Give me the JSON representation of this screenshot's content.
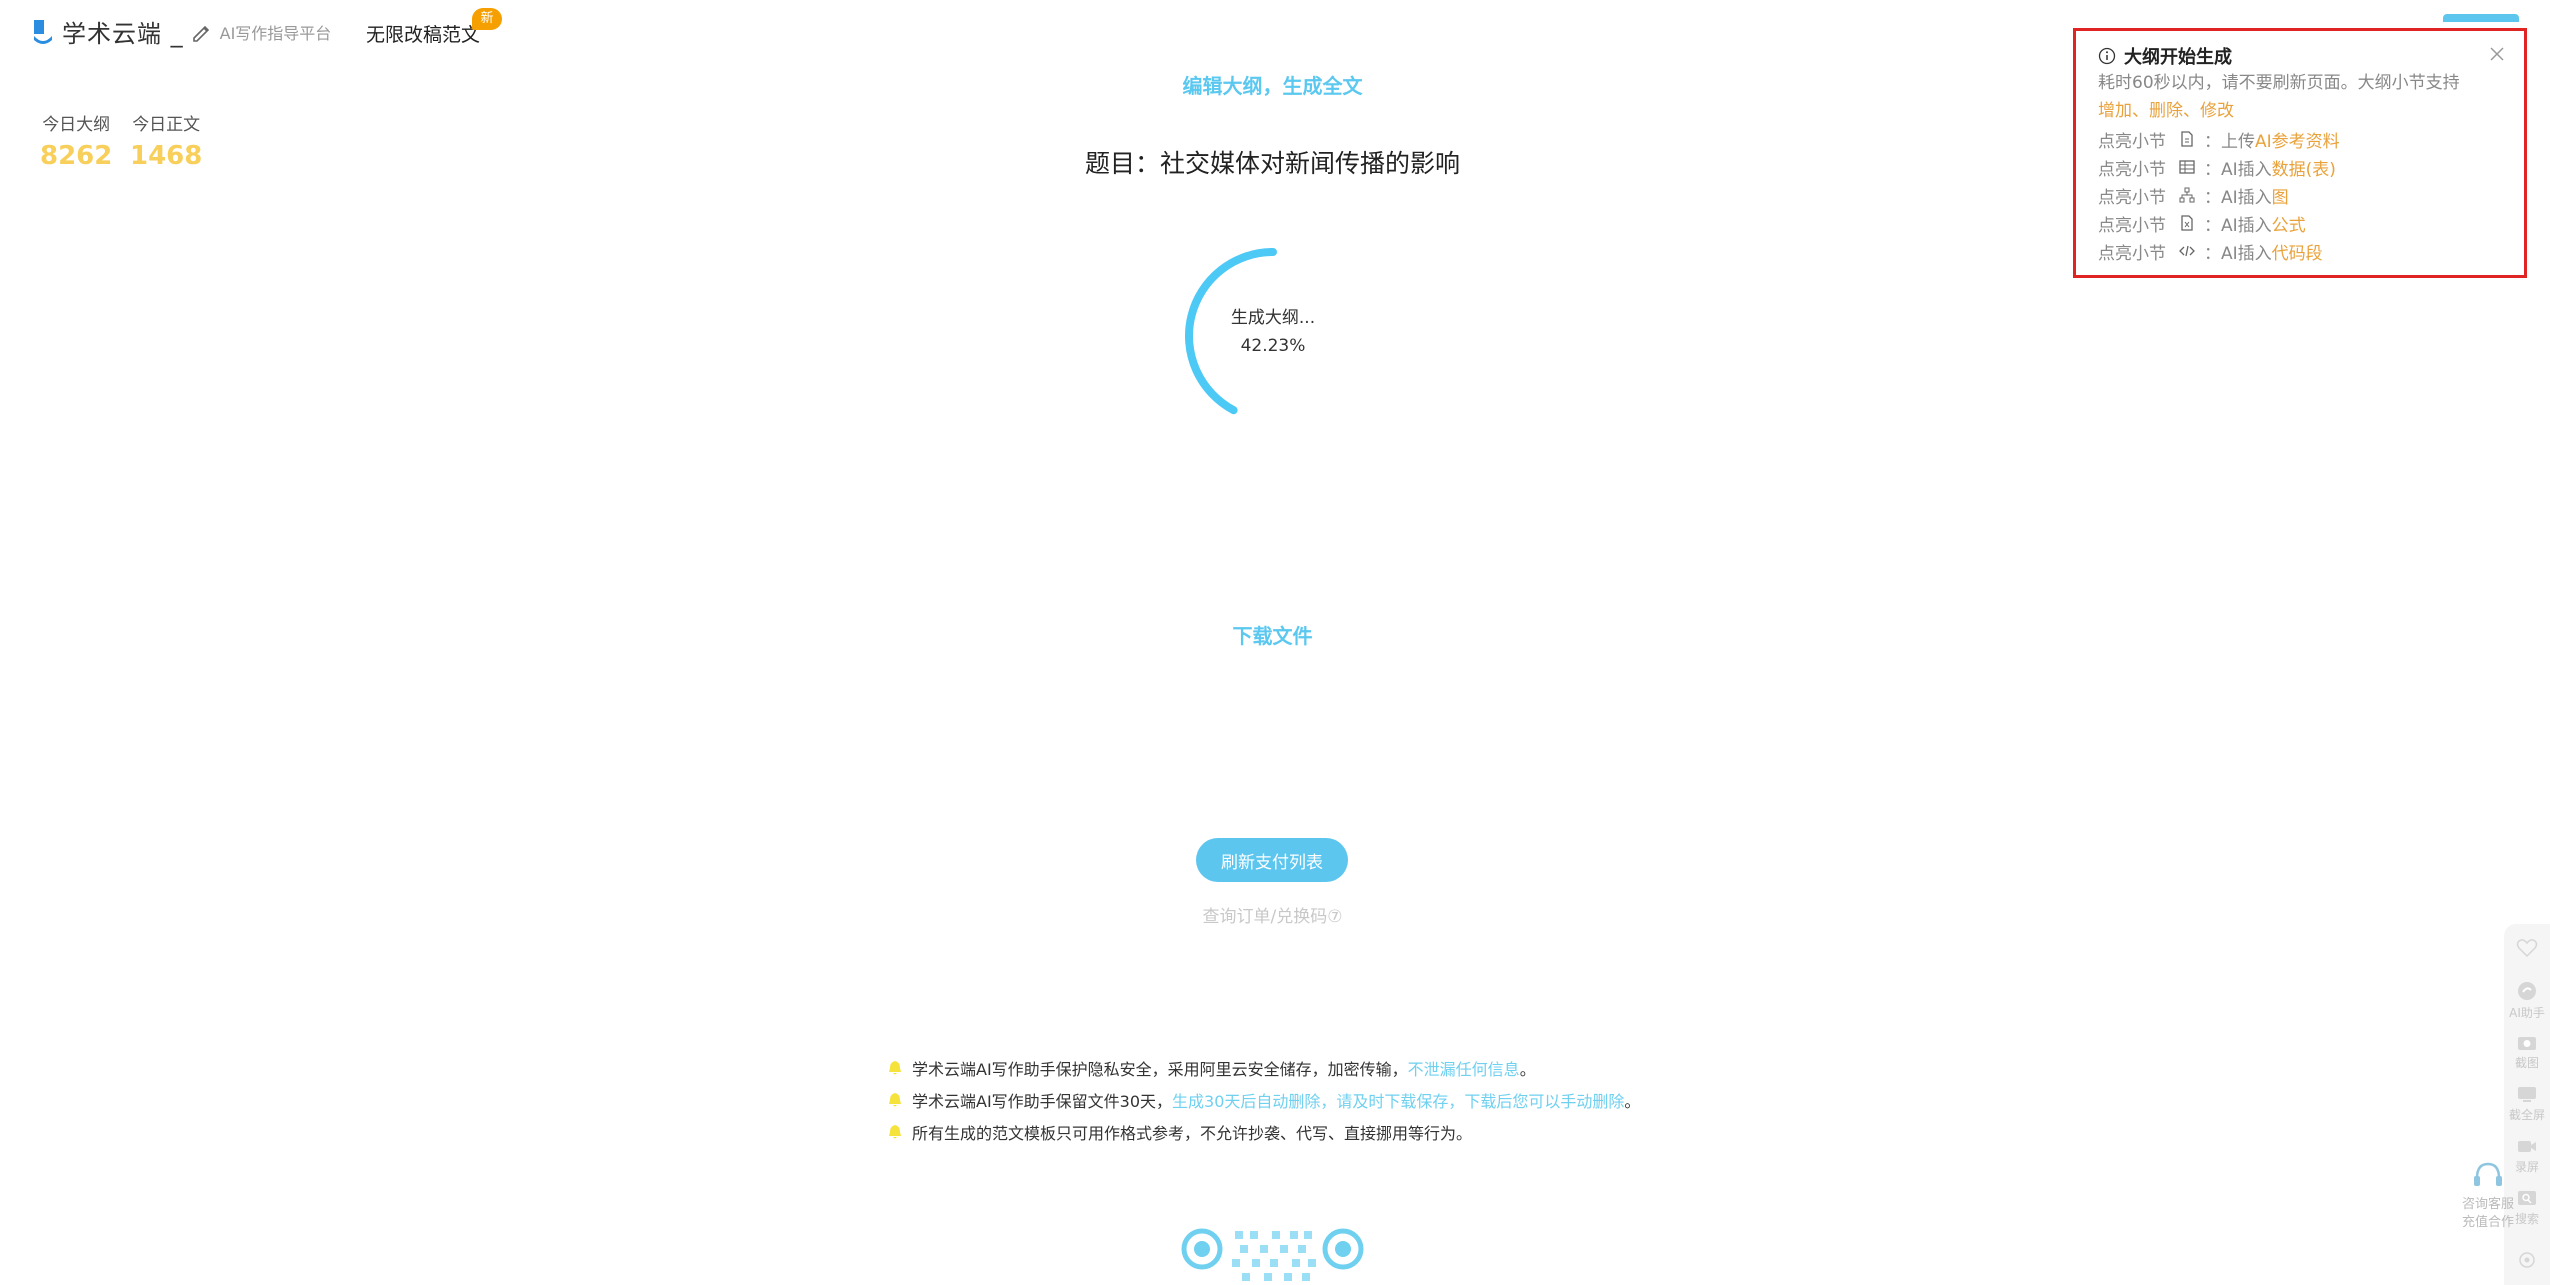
{
  "header": {
    "brand": "学术云端 _",
    "subtitle": "AI写作指导平台",
    "nav_link": "无限改稿范文",
    "badge": "新"
  },
  "stats": {
    "outline_label": "今日大纲",
    "outline_value": "8262",
    "body_label": "今日正文",
    "body_value": "1468"
  },
  "main": {
    "edit_link": "编辑大纲，生成全文",
    "topic": "题目：社交媒体对新闻传播的影响",
    "progress_label": "生成大纲...",
    "progress_text": "42.23%",
    "progress_value": 42.23,
    "download_link": "下载文件",
    "refresh_button": "刷新支付列表",
    "query_link": "查询订单/兑换码⑦"
  },
  "notices": [
    {
      "text": "学术云端AI写作助手保护隐私安全，采用阿里云安全储存，加密传输，",
      "highlight": "不泄漏任何信息",
      "tail": "。"
    },
    {
      "text": "学术云端AI写作助手保留文件30天，",
      "highlight": "生成30天后自动删除，请及时下载保存，下载后您可以手动删除",
      "tail": "。"
    },
    {
      "text": "所有生成的范文模板只可用作格式参考，不允许抄袭、代写、直接挪用等行为。",
      "highlight": "",
      "tail": ""
    }
  ],
  "popup": {
    "title": "大纲开始生成",
    "line1": "耗时60秒以内，请不要刷新页面。大纲小节支持",
    "line2": "增加、删除、修改",
    "features": [
      {
        "prefix": "点亮小节",
        "icon": "file-icon",
        "action": "：上传",
        "highlight": "AI参考资料"
      },
      {
        "prefix": "点亮小节",
        "icon": "table-icon",
        "action": "：AI插入",
        "highlight": "数据(表)"
      },
      {
        "prefix": "点亮小节",
        "icon": "diagram-icon",
        "action": "：AI插入",
        "highlight": "图"
      },
      {
        "prefix": "点亮小节",
        "icon": "formula-icon",
        "action": "：AI插入",
        "highlight": "公式"
      },
      {
        "prefix": "点亮小节",
        "icon": "code-icon",
        "action": "：AI插入",
        "highlight": "代码段"
      }
    ]
  },
  "sidebar": {
    "items": [
      "AI助手",
      "截图",
      "截全屏",
      "录屏",
      "搜索"
    ],
    "support_line1": "咨询客服",
    "support_line2": "充值合作"
  },
  "colors": {
    "accent": "#5cc6ef",
    "stat": "#f7cf5a",
    "highlight_orange": "#e9a23b",
    "popup_border": "#e02424"
  }
}
